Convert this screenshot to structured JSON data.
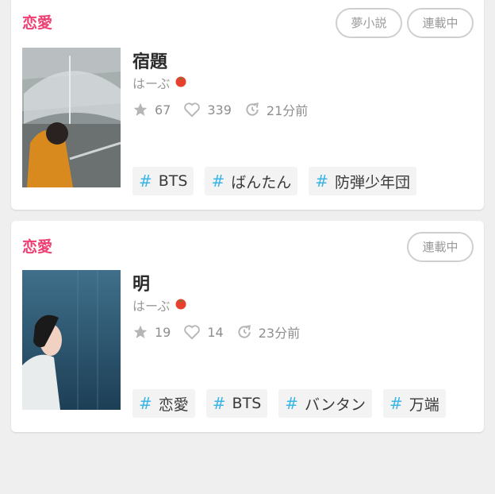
{
  "colors": {
    "genre": "#ee3f73",
    "hashtag": "#3ab5e5",
    "tomato": "#e8402e"
  },
  "stories": [
    {
      "genre": "恋愛",
      "badges": [
        "夢小説",
        "連載中"
      ],
      "title": "宿題",
      "author": "はーぶ",
      "author_icon": "tomato-icon",
      "stars": "67",
      "likes": "339",
      "updated": "21分前",
      "tags": [
        "BTS",
        "ばんたん",
        "防弾少年団"
      ]
    },
    {
      "genre": "恋愛",
      "badges": [
        "連載中"
      ],
      "title": "明",
      "author": "はーぶ",
      "author_icon": "tomato-icon",
      "stars": "19",
      "likes": "14",
      "updated": "23分前",
      "tags": [
        "恋愛",
        "BTS",
        "バンタン",
        "万端"
      ]
    }
  ]
}
